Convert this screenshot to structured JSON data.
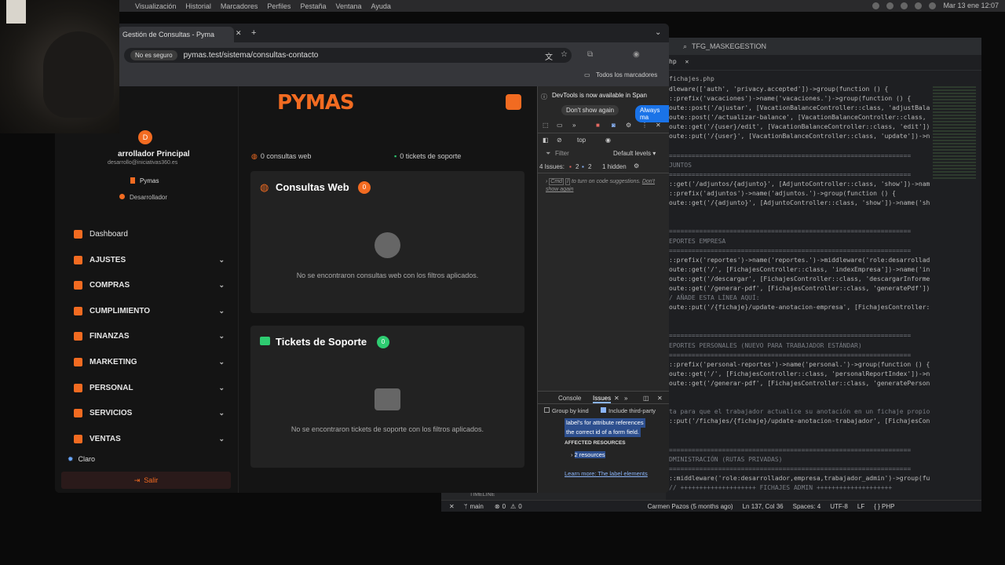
{
  "menubar": {
    "items": [
      "Visualización",
      "Historial",
      "Marcadores",
      "Perfiles",
      "Pestaña",
      "Ventana",
      "Ayuda"
    ],
    "clock": "Mar 13 ene 12:07"
  },
  "browser": {
    "tab_title": "Gestión de Consultas - Pyma",
    "not_secure": "No es seguro",
    "url": "pymas.test/sistema/consultas-contacto",
    "bookmarks": "Todos los marcadores"
  },
  "app": {
    "logo": "PYMAS",
    "user": {
      "initial": "D",
      "name": "arrollador Principal",
      "email": "desarrollo@iniciativas360.es",
      "company": "Pymas",
      "role": "Desarrollador"
    },
    "nav": [
      {
        "label": "Dashboard",
        "chev": false
      },
      {
        "label": "AJUSTES",
        "chev": true
      },
      {
        "label": "COMPRAS",
        "chev": true
      },
      {
        "label": "CUMPLIMIENTO",
        "chev": true
      },
      {
        "label": "FINANZAS",
        "chev": true
      },
      {
        "label": "MARKETING",
        "chev": true
      },
      {
        "label": "PERSONAL",
        "chev": true
      },
      {
        "label": "SERVICIOS",
        "chev": true
      },
      {
        "label": "VENTAS",
        "chev": true
      }
    ],
    "theme": "Claro",
    "logout": "Salir",
    "stats": {
      "web": "0 consultas web",
      "support": "0 tickets de soporte"
    },
    "web_card": {
      "title": "Consultas Web",
      "count": "0",
      "empty": "No se encontraron consultas web con los filtros aplicados."
    },
    "ticket_card": {
      "title": "Tickets de Soporte",
      "count": "0",
      "empty": "No se encontraron tickets de soporte con los filtros aplicados."
    }
  },
  "devtools": {
    "banner": "DevTools is now available in Span",
    "dont_show": "Don't show again",
    "always": "Always ma",
    "context": "top",
    "filter": "Filter",
    "levels": "Default levels ▾",
    "issues_count": "4 Issues:",
    "err": "2",
    "info": "2",
    "hidden": "1 hidden",
    "hint_key": "Cmd",
    "hint_i": "I",
    "hint": "to turn on code suggestions.",
    "hint_dont": "Don't show again",
    "tab_console": "Console",
    "tab_issues": "Issues",
    "group_kind": "Group by kind",
    "third_party": "Include third-party",
    "issue_text1": "label's for attribute references",
    "issue_text2": "the correct id of a form field.",
    "affected": "AFFECTED RESOURCES",
    "resources": "2 resources",
    "learn": "Learn more: The label elements"
  },
  "editor": {
    "title": "TFG_MASKEGESTION",
    "tab": "hp",
    "file": "fichajes.php",
    "lines": [
      [
        "dleware(['auth', 'privacy.accepted'])->group(function () {",
        ""
      ],
      [
        "::prefix('vacaciones')->name('vacaciones.')->group(function () {",
        ""
      ],
      [
        "oute::post('/ajustar', [VacationBalanceController::class, 'adjustBala",
        ""
      ],
      [
        "oute::post('/actualizar-balance', [VacationBalanceController::class,",
        ""
      ],
      [
        "oute::get('/{user}/edit', [VacationBalanceController::class, 'edit'])",
        ""
      ],
      [
        "oute::put('/{user}', [VacationBalanceController::class, 'update'])->n",
        ""
      ],
      [
        "",
        ""
      ],
      [
        "================================================================",
        "c-cm"
      ],
      [
        "JUNTOS",
        "c-cm"
      ],
      [
        "================================================================",
        "c-cm"
      ],
      [
        "::get('/adjuntos/{adjunto}', [AdjuntoController::class, 'show'])->nam",
        ""
      ],
      [
        "::prefix('adjuntos')->name('adjuntos.')->group(function () {",
        ""
      ],
      [
        "oute::get('/{adjunto}', [AdjuntoController::class, 'show'])->name('sh",
        ""
      ],
      [
        "",
        ""
      ],
      [
        "",
        ""
      ],
      [
        "================================================================",
        "c-cm"
      ],
      [
        "EPORTES EMPRESA",
        "c-cm"
      ],
      [
        "================================================================",
        "c-cm"
      ],
      [
        "::prefix('reportes')->name('reportes.')->middleware('role:desarrollad",
        ""
      ],
      [
        "oute::get('/', [FichajesController::class, 'indexEmpresa'])->name('in",
        ""
      ],
      [
        "oute::get('/descargar', [FichajesController::class, 'descargarInforme",
        ""
      ],
      [
        "oute::get('/generar-pdf', [FichajesController::class, 'generatePdf'])",
        ""
      ],
      [
        "/ AÑADE ESTA LÍNEA AQUÍ:",
        "c-cm"
      ],
      [
        "oute::put('/{fichaje}/update-anotacion-empresa', [FichajesController:",
        ""
      ],
      [
        "",
        ""
      ],
      [
        "",
        ""
      ],
      [
        "================================================================",
        "c-cm"
      ],
      [
        "EPORTES PERSONALES (NUEVO PARA TRABAJADOR ESTÁNDAR)",
        "c-cm"
      ],
      [
        "================================================================",
        "c-cm"
      ],
      [
        "::prefix('personal-reportes')->name('personal.')->group(function () {",
        ""
      ],
      [
        "oute::get('/', [FichajesController::class, 'personalReportIndex'])->n",
        ""
      ],
      [
        "oute::get('/generar-pdf', [FichajesController::class, 'generatePerson",
        ""
      ],
      [
        "",
        ""
      ],
      [
        "",
        ""
      ],
      [
        "ta para que el trabajador actualice su anotación en un fichaje propio",
        "c-cm"
      ],
      [
        "::put('/fichajes/{fichaje}/update-anotacion-trabajador', [FichajesCon",
        ""
      ],
      [
        "",
        ""
      ],
      [
        "",
        ""
      ],
      [
        "================================================================",
        "c-cm"
      ],
      [
        "DMINISTRACIÓN (RUTAS PRIVADAS)",
        "c-cm"
      ],
      [
        "================================================================",
        "c-cm"
      ],
      [
        "::middleware('role:desarrollador,empresa,trabajador_admin')->group(fu",
        ""
      ],
      [
        "// ++++++++++++++++++++ FICHAJES ADMIN ++++++++++++++++++++",
        "c-cm"
      ]
    ],
    "timeline": "TIMELINE",
    "status": {
      "branch": "main",
      "errors": "0",
      "warnings": "0",
      "blame": "Carmen Pazos (5 months ago)",
      "pos": "Ln 137, Col 36",
      "spaces": "Spaces: 4",
      "enc": "UTF-8",
      "eol": "LF",
      "lang": "{ } PHP"
    }
  }
}
